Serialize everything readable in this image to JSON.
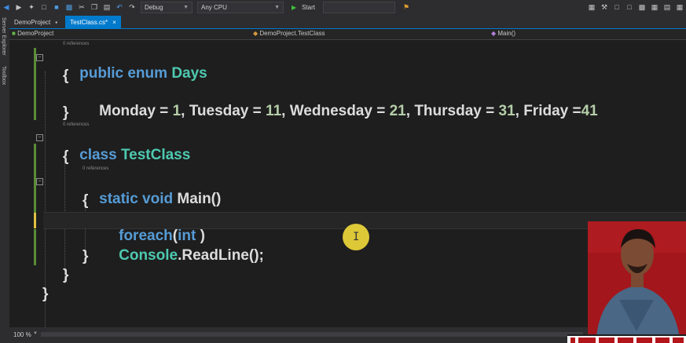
{
  "toolbar": {
    "config": "Debug",
    "platform": "Any CPU",
    "start": "Start"
  },
  "tabs": [
    {
      "label": "DemoProject",
      "pin": "▪"
    },
    {
      "label": "TestClass.cs*",
      "close": "×"
    }
  ],
  "sidebar": {
    "item1": "Server Explorer",
    "item2": "Toolbox"
  },
  "nav": {
    "project": "DemoProject",
    "class": "DemoProject.TestClass",
    "member": "Main()"
  },
  "code": {
    "refs": "0 references",
    "line1": {
      "k1": "public",
      "k2": "enum",
      "name": "Days"
    },
    "brace_open": "{",
    "brace_close": "}",
    "enum_values": [
      {
        "name": "Monday",
        "eq": " = ",
        "val": "1",
        "sep": ", "
      },
      {
        "name": "Tuesday",
        "eq": " = ",
        "val": "11",
        "sep": ", "
      },
      {
        "name": "Wednesday",
        "eq": " = ",
        "val": "21",
        "sep": ", "
      },
      {
        "name": "Thursday",
        "eq": " = ",
        "val": "31",
        "sep": ", "
      },
      {
        "name": "Friday",
        "eq": " =",
        "val": "41",
        "sep": ""
      }
    ],
    "class_line": {
      "k": "class",
      "name": "TestClass"
    },
    "main_line": {
      "k1": "static",
      "k2": "void",
      "name": "Main()"
    },
    "foreach_line": {
      "k": "foreach",
      "paren": "(",
      "k2": "int",
      "rest": " )"
    },
    "console_line": {
      "type": "Console",
      "rest": ".ReadLine();"
    }
  },
  "status": {
    "zoom": "100 %"
  },
  "colors": {
    "accent": "#007acc",
    "keyword": "#569cd6",
    "type": "#4ec9b0",
    "number": "#b5cea8"
  }
}
